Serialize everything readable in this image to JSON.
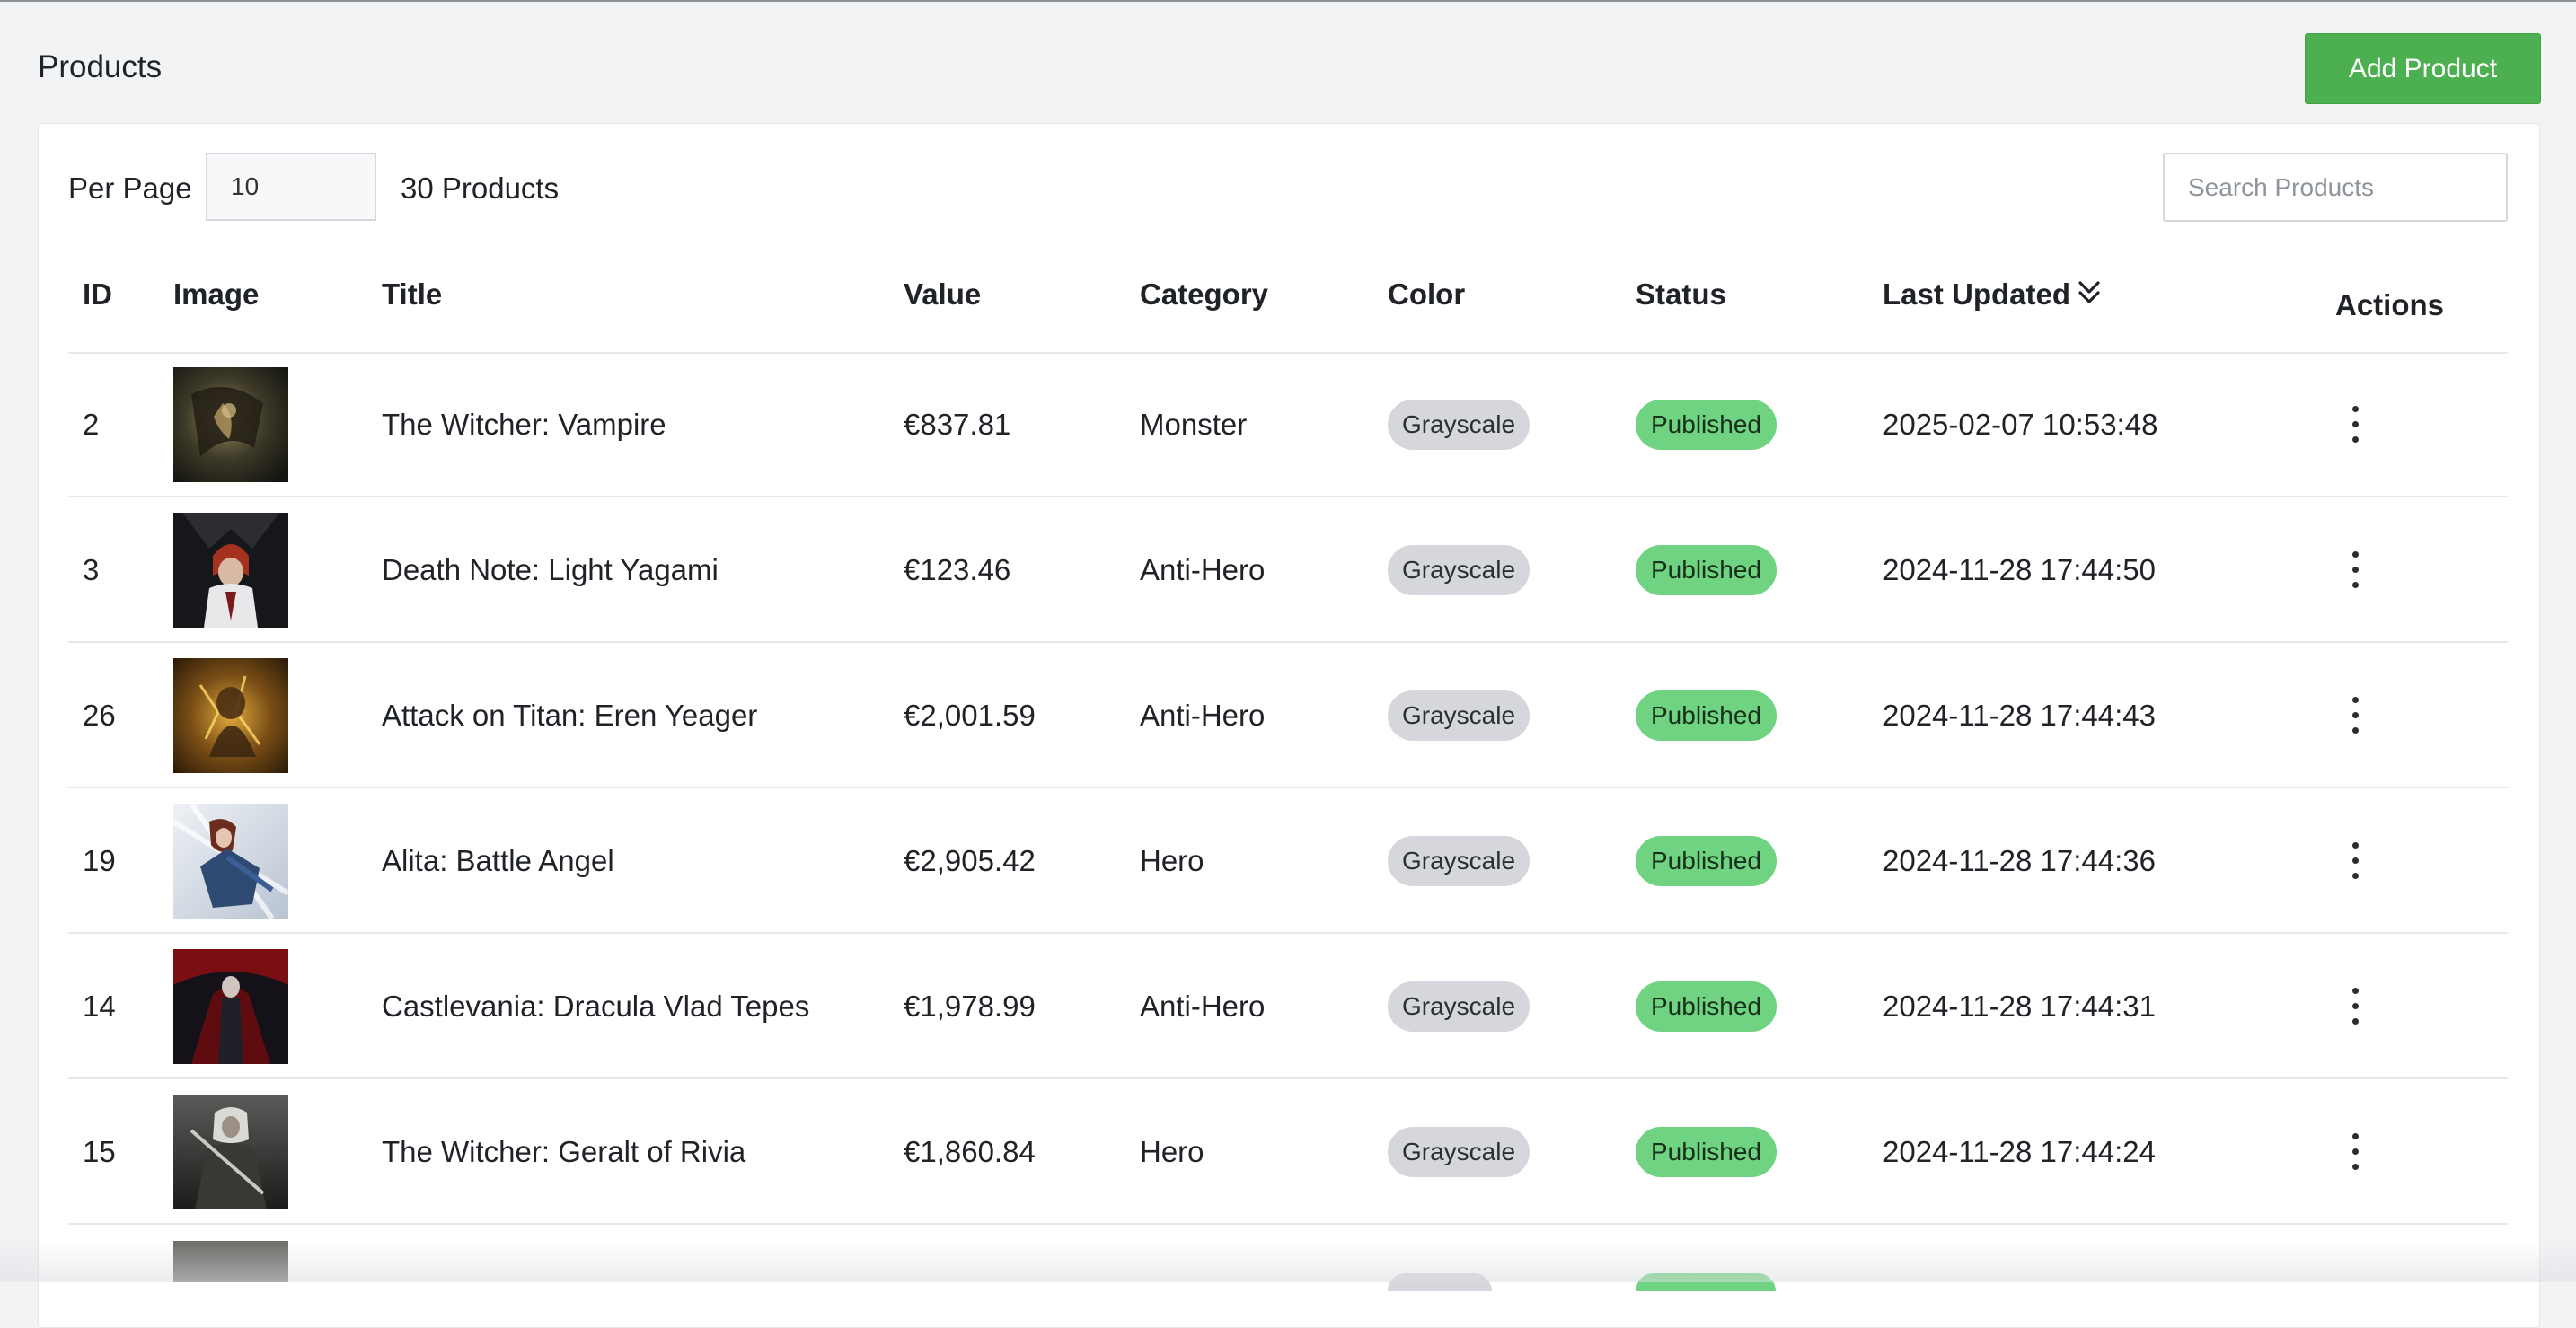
{
  "header": {
    "title": "Products",
    "add_button": "Add Product"
  },
  "toolbar": {
    "per_page_label": "Per Page",
    "per_page_value": "10",
    "product_count": "30 Products",
    "search_placeholder": "Search Products"
  },
  "table": {
    "columns": [
      "ID",
      "Image",
      "Title",
      "Value",
      "Category",
      "Color",
      "Status",
      "Last Updated",
      "Actions"
    ],
    "sorted_column": "Last Updated",
    "sort_icon": "double-chevron-down-icon",
    "rows": [
      {
        "id": "2",
        "title": "The Witcher: Vampire",
        "value": "€837.81",
        "category": "Monster",
        "color": "Grayscale",
        "status": "Published",
        "updated": "2025-02-07 10:53:48",
        "image": "vampire-artwork"
      },
      {
        "id": "3",
        "title": "Death Note: Light Yagami",
        "value": "€123.46",
        "category": "Anti-Hero",
        "color": "Grayscale",
        "status": "Published",
        "updated": "2024-11-28 17:44:50",
        "image": "light-yagami-artwork"
      },
      {
        "id": "26",
        "title": "Attack on Titan: Eren Yeager",
        "value": "€2,001.59",
        "category": "Anti-Hero",
        "color": "Grayscale",
        "status": "Published",
        "updated": "2024-11-28 17:44:43",
        "image": "eren-yeager-artwork"
      },
      {
        "id": "19",
        "title": "Alita: Battle Angel",
        "value": "€2,905.42",
        "category": "Hero",
        "color": "Grayscale",
        "status": "Published",
        "updated": "2024-11-28 17:44:36",
        "image": "alita-artwork"
      },
      {
        "id": "14",
        "title": "Castlevania: Dracula Vlad Tepes",
        "value": "€1,978.99",
        "category": "Anti-Hero",
        "color": "Grayscale",
        "status": "Published",
        "updated": "2024-11-28 17:44:31",
        "image": "dracula-artwork"
      },
      {
        "id": "15",
        "title": "The Witcher: Geralt of Rivia",
        "value": "€1,860.84",
        "category": "Hero",
        "color": "Grayscale",
        "status": "Published",
        "updated": "2024-11-28 17:44:24",
        "image": "geralt-artwork"
      }
    ]
  },
  "colors": {
    "accent_green": "#4caf50",
    "badge_published": "#6fd381",
    "badge_color": "#d5d7dc",
    "background": "#f2f3f5"
  },
  "icons": {
    "row_actions": "kebab-menu-icon"
  }
}
